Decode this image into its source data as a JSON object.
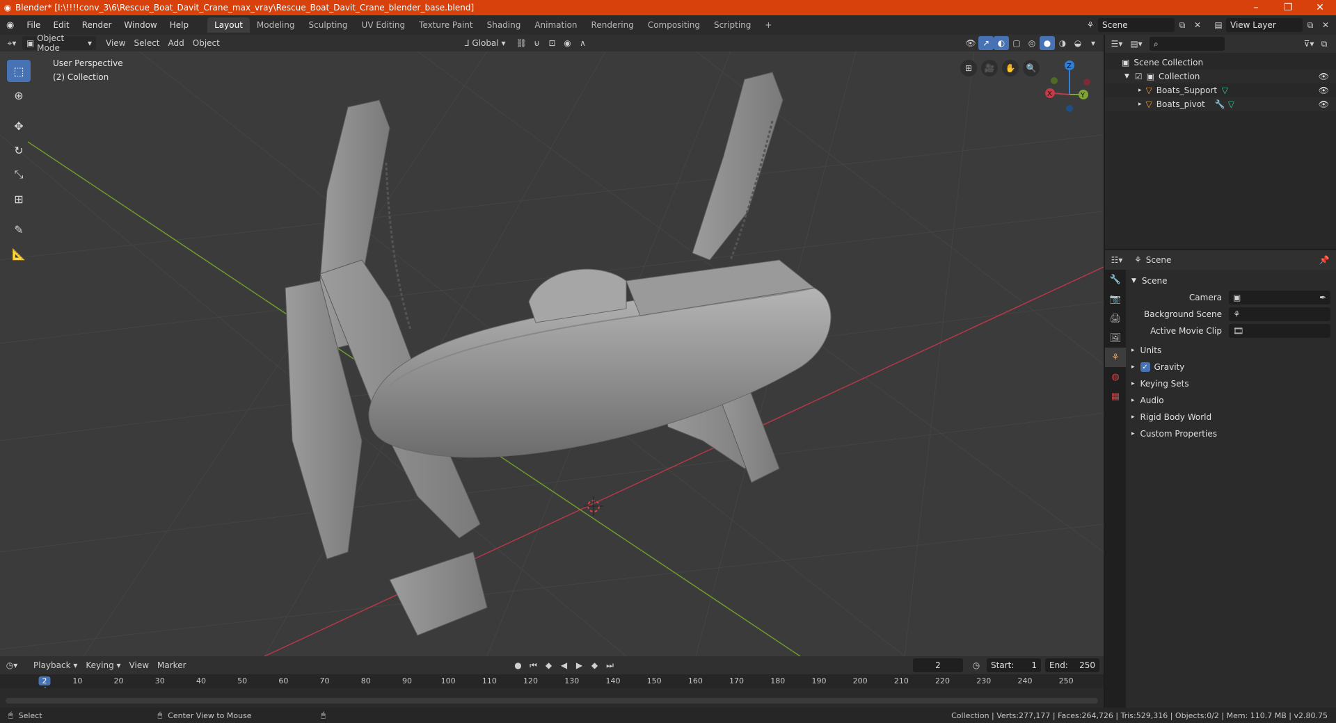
{
  "titlebar": {
    "title": "Blender* [I:\\!!!!conv_3\\6\\Rescue_Boat_Davit_Crane_max_vray\\Rescue_Boat_Davit_Crane_blender_base.blend]",
    "minimize": "–",
    "maximize": "❐",
    "close": "✕"
  },
  "menubar": {
    "menus": [
      "File",
      "Edit",
      "Render",
      "Window",
      "Help"
    ],
    "workspaces": [
      "Layout",
      "Modeling",
      "Sculpting",
      "UV Editing",
      "Texture Paint",
      "Shading",
      "Animation",
      "Rendering",
      "Compositing",
      "Scripting"
    ],
    "add_workspace": "+",
    "scene_label": "Scene",
    "view_layer_label": "View Layer"
  },
  "viewport_header": {
    "mode": "Object Mode",
    "menus": [
      "View",
      "Select",
      "Add",
      "Object"
    ],
    "orientation": "Global"
  },
  "viewport": {
    "perspective": "User Perspective",
    "collection": "(2) Collection",
    "gizmo": {
      "x": "X",
      "y": "Y",
      "z": "Z"
    }
  },
  "outliner": {
    "root": "Scene Collection",
    "collection": "Collection",
    "objects": [
      "Boats_Support",
      "Boats_pivot"
    ]
  },
  "properties": {
    "context": "Scene",
    "panel_title": "Scene",
    "camera_label": "Camera",
    "background_scene_label": "Background Scene",
    "active_movie_clip_label": "Active Movie Clip",
    "subpanels": [
      "Units",
      "Gravity",
      "Keying Sets",
      "Audio",
      "Rigid Body World",
      "Custom Properties"
    ],
    "gravity_checked": true
  },
  "timeline": {
    "menus": [
      "Playback",
      "Keying",
      "View",
      "Marker"
    ],
    "current_frame": "2",
    "start_label": "Start:",
    "start": "1",
    "end_label": "End:",
    "end": "250",
    "ruler": [
      "2",
      "10",
      "20",
      "30",
      "40",
      "50",
      "60",
      "70",
      "80",
      "90",
      "100",
      "110",
      "120",
      "130",
      "140",
      "150",
      "160",
      "170",
      "180",
      "190",
      "200",
      "210",
      "220",
      "230",
      "240",
      "250"
    ]
  },
  "statusbar": {
    "select": "Select",
    "center_view": "Center View to Mouse",
    "stats": "Collection | Verts:277,177 | Faces:264,726 | Tris:529,316 | Objects:0/2 | Mem: 110.7 MB | v2.80.75"
  },
  "colors": {
    "titlebar": "#d8400c",
    "accent": "#4772b3",
    "viewport_bg": "#3b3b3b",
    "x_axis": "#c33b48",
    "y_axis": "#7da434",
    "z_axis": "#2f7fd8"
  }
}
